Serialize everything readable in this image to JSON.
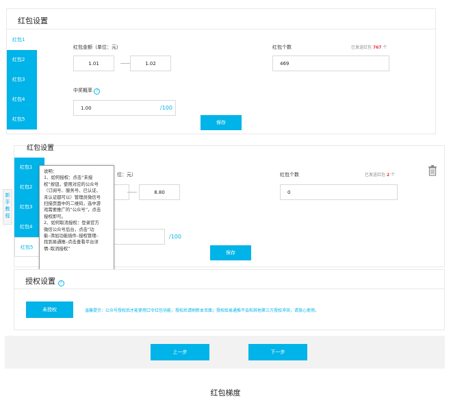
{
  "section1": {
    "title": "红包设置",
    "tabs": [
      "红包1",
      "红包2",
      "红包3",
      "红包4",
      "红包5"
    ],
    "amount_label": "红包金额（单位：元）",
    "amount_min": "1.01",
    "amount_max": "1.02",
    "count_label": "红包个数",
    "count_value": "469",
    "sent_prefix": "已发送红包",
    "sent_count": "767",
    "sent_suffix": "个",
    "rate_label": "中奖概率",
    "rate_value": "1.00",
    "rate_unit": "/100",
    "save_label": "保存"
  },
  "section2": {
    "title": "红包设置",
    "tabs": [
      "红包1",
      "红包2",
      "红包3",
      "红包4",
      "红包5"
    ],
    "amount_label_fragment": "位：元）",
    "amount_max": "8.80",
    "count_label": "红包个数",
    "count_value": "0",
    "sent_prefix": "已发送红包",
    "sent_count": "2",
    "sent_suffix": "个",
    "rate_unit": "/100",
    "save_label": "保存"
  },
  "side_tab": "新手教程",
  "tooltip": {
    "lines": [
      "说明：",
      "1、如何授权：点击“未授",
      "权”按钮，使用对应的公众号",
      "（订阅号、服务号、已认证、",
      "未认证都可以）管理员微信号",
      "扫描页面中的二维码，选中游",
      "戏需要推广的“公众号”，点击",
      "授权即可。",
      "2、如何取消授权：登录官方",
      "微信公众号后台，点击“功",
      "能–添加功能插件–授权管理–",
      "找到易通推–点击查看平台详",
      "情–取消授权”"
    ]
  },
  "auth": {
    "title": "授权设置",
    "button_label": "未授权",
    "tip": "温馨提示：公众号授权后才能使用口令红包功能，授权后请刷新本页面；授权给易通推不会和其他第三方授权冲突，请放心使用。"
  },
  "nav": {
    "prev_label": "上一步",
    "next_label": "下一步"
  },
  "caption": "红包梯度",
  "colors": {
    "accent": "#00b3e8",
    "highlight": "#e8303b"
  },
  "icons": {
    "trash": "trash-icon",
    "help": "question-icon"
  }
}
